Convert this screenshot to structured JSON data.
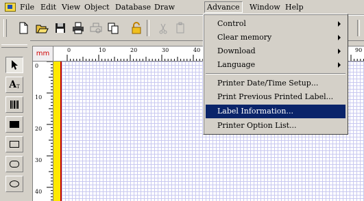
{
  "menubar": {
    "items": [
      {
        "label": "File"
      },
      {
        "label": "Edit"
      },
      {
        "label": "View"
      },
      {
        "label": "Object"
      },
      {
        "label": "Database"
      },
      {
        "label": "Draw"
      },
      {
        "label": "Advance"
      },
      {
        "label": "Window"
      },
      {
        "label": "Help"
      }
    ]
  },
  "toolbar": {
    "buttons": [
      {
        "icon": "new-document-icon"
      },
      {
        "icon": "open-folder-icon"
      },
      {
        "icon": "save-disk-icon"
      },
      {
        "icon": "print-icon"
      },
      {
        "icon": "print-preview-icon"
      },
      {
        "icon": "copy-pages-icon"
      },
      {
        "icon": "lock-icon"
      },
      {
        "icon": "cut-icon"
      },
      {
        "icon": "paste-icon"
      }
    ]
  },
  "palette": {
    "tools": [
      {
        "icon": "pointer-arrow-icon"
      },
      {
        "icon": "text-tool-icon"
      },
      {
        "icon": "barcode-tool-icon"
      },
      {
        "icon": "filled-rectangle-icon"
      },
      {
        "icon": "rectangle-outline-icon"
      },
      {
        "icon": "rounded-rectangle-icon"
      },
      {
        "icon": "ellipse-icon"
      }
    ],
    "text_tool_label": "A"
  },
  "canvas": {
    "unit": "mm",
    "hruler_labels": [
      "0",
      "10",
      "20",
      "30",
      "40",
      "90"
    ],
    "vruler_labels": [
      "0",
      "10",
      "20",
      "30",
      "40"
    ]
  },
  "advance_menu": {
    "items": [
      {
        "label": "Control",
        "submenu": true
      },
      {
        "label": "Clear memory",
        "submenu": true
      },
      {
        "label": "Download",
        "submenu": true
      },
      {
        "label": "Language",
        "submenu": true
      },
      {
        "label": "Printer Date/Time Setup...",
        "submenu": false
      },
      {
        "label": "Print Previous Printed Label...",
        "submenu": false
      },
      {
        "label": "Label Information...",
        "submenu": false,
        "highlighted": true
      },
      {
        "label": "Printer Option List...",
        "submenu": false
      }
    ],
    "highlight_color": "#0a246a"
  }
}
